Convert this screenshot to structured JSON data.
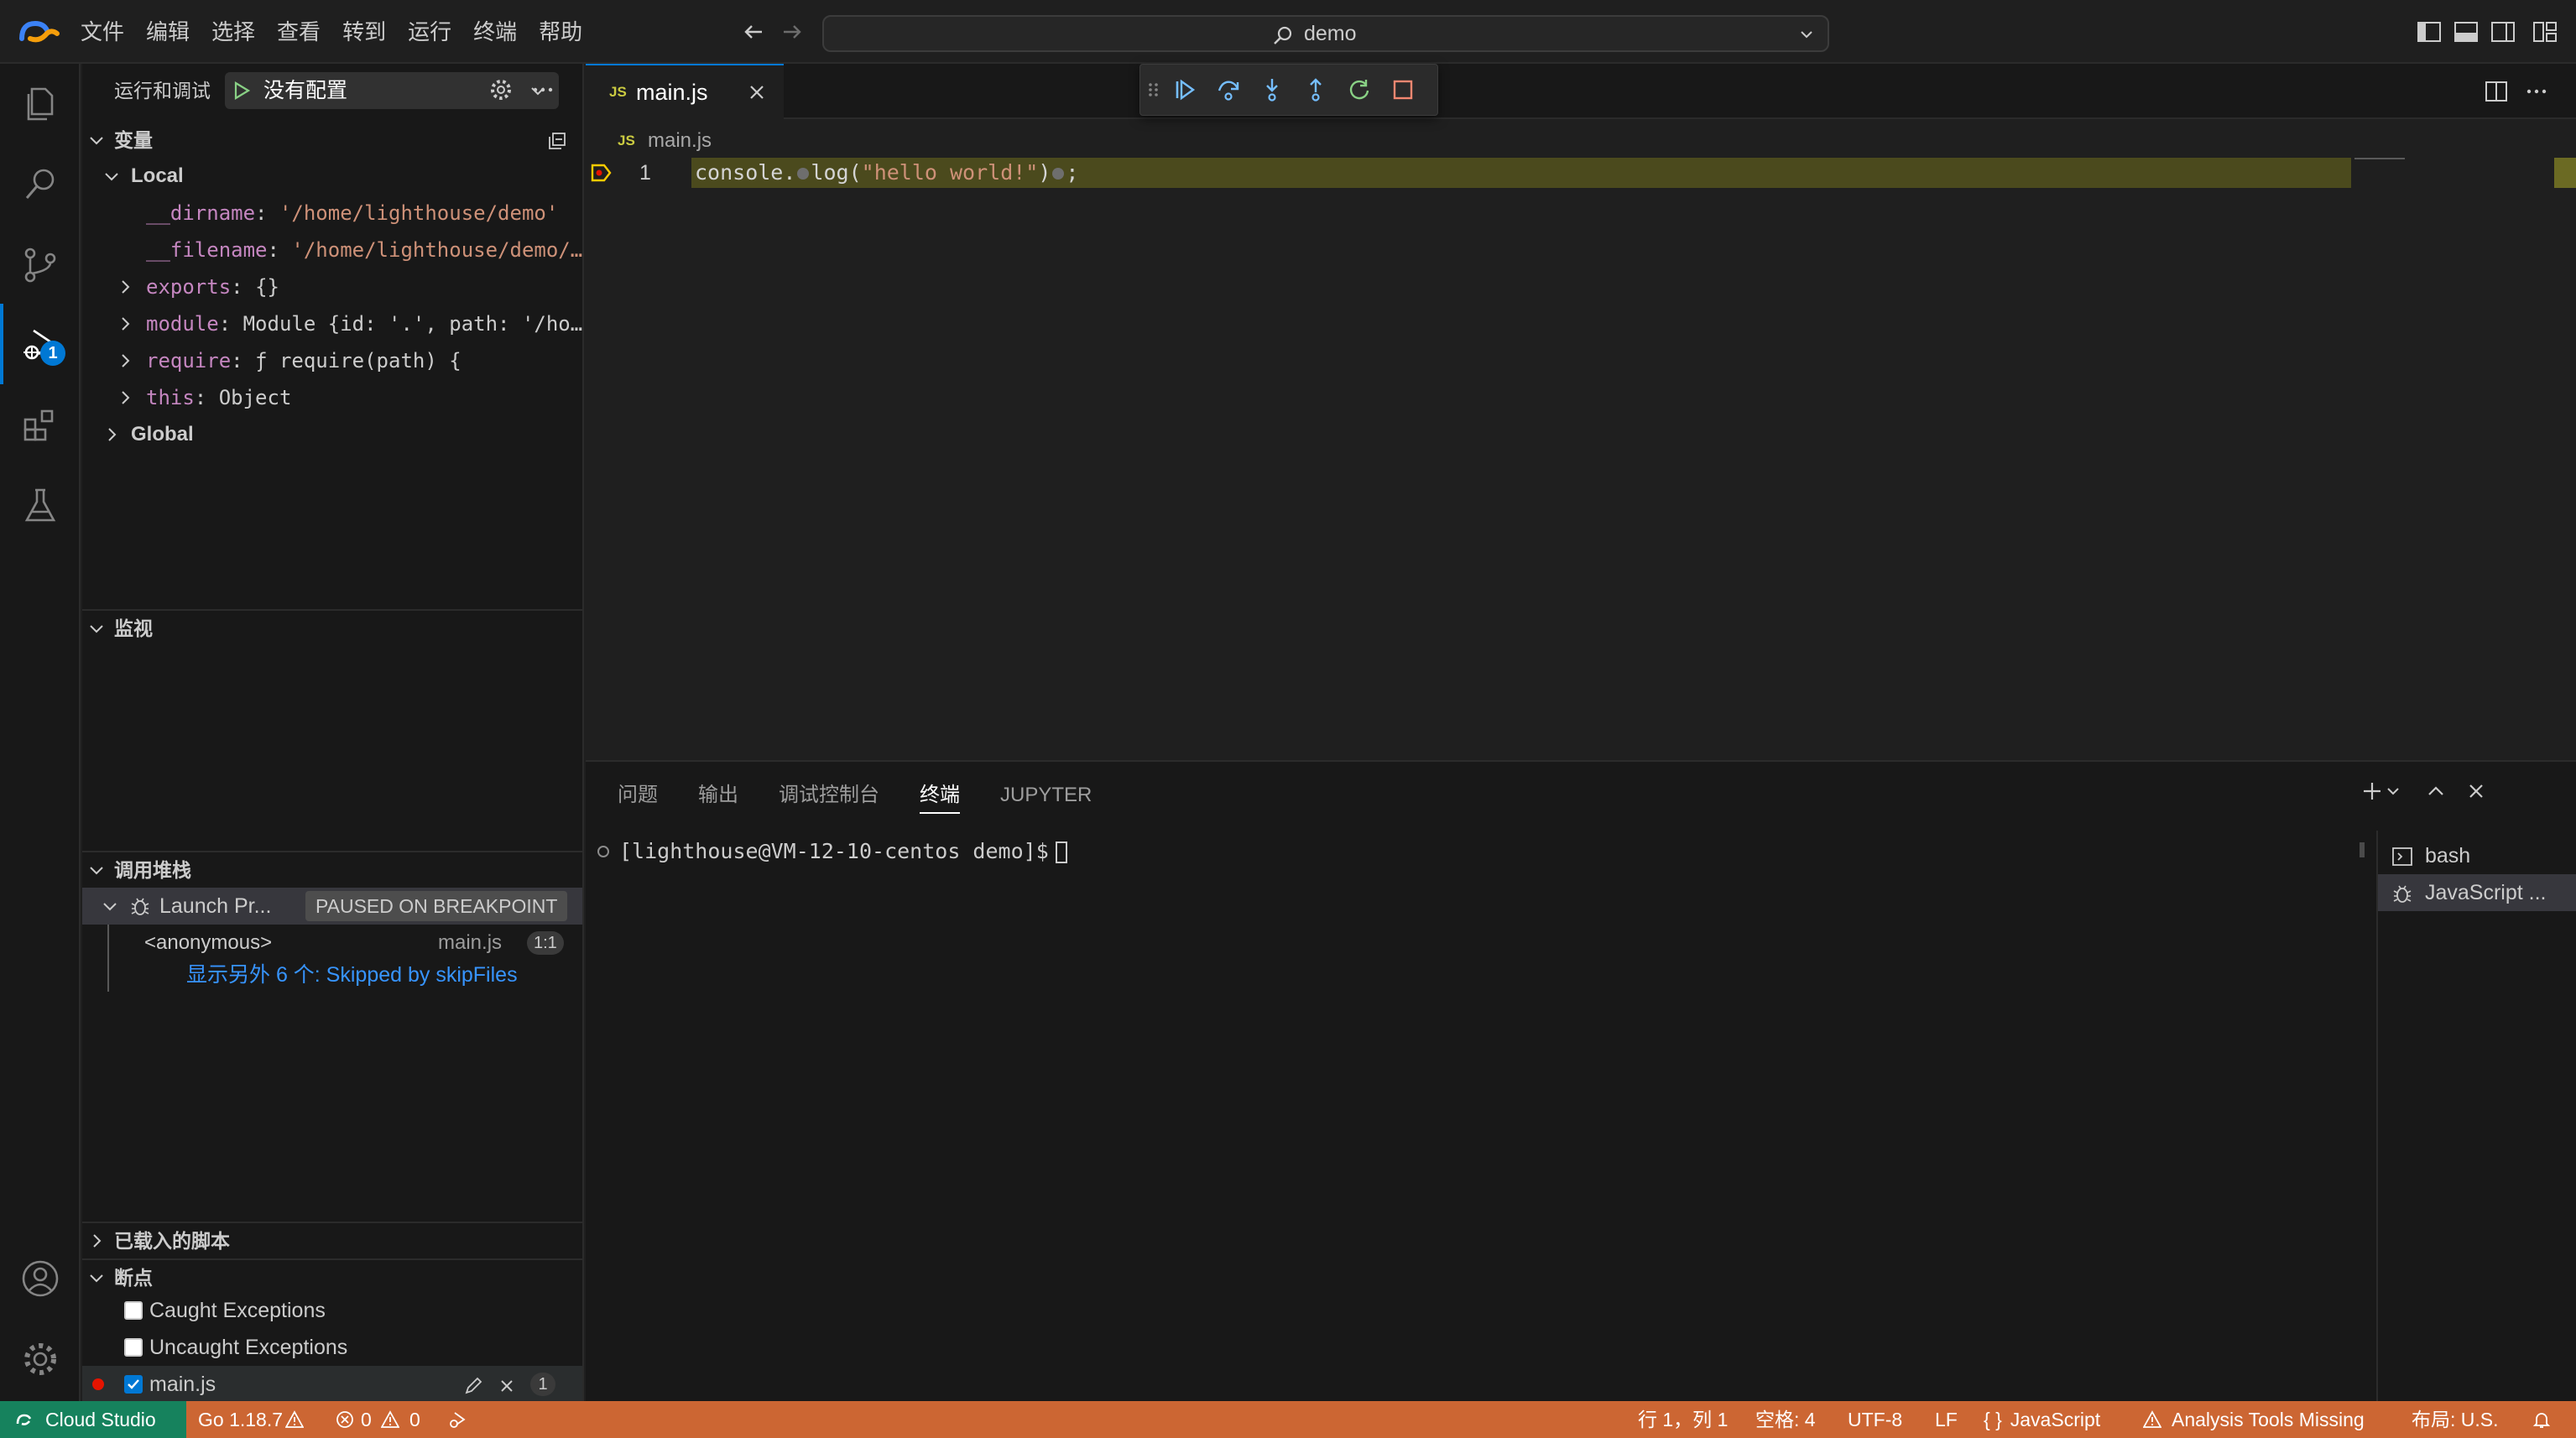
{
  "menu": [
    "文件",
    "编辑",
    "选择",
    "查看",
    "转到",
    "运行",
    "终端",
    "帮助"
  ],
  "command_center": {
    "label": "demo"
  },
  "sidebar": {
    "title": "运行和调试",
    "run_config": "没有配置",
    "variables": {
      "title": "变量",
      "local_label": "Local",
      "items": [
        {
          "name": "__dirname",
          "value": "'/home/lighthouse/demo'"
        },
        {
          "name": "__filename",
          "value": "'/home/lighthouse/demo/…"
        },
        {
          "name": "exports",
          "value": "{}"
        },
        {
          "name": "module",
          "value": "Module {id: '.', path: '/ho…"
        },
        {
          "name": "require",
          "value": "ƒ require(path) {"
        },
        {
          "name": "this",
          "value": "Object"
        }
      ],
      "global_label": "Global"
    },
    "watch": {
      "title": "监视"
    },
    "call_stack": {
      "title": "调用堆栈",
      "thread": "Launch Pr...",
      "status": "PAUSED ON BREAKPOINT",
      "frame": {
        "name": "<anonymous>",
        "file": "main.js",
        "pos": "1:1"
      },
      "skipped": "显示另外 6 个: Skipped by skipFiles"
    },
    "loaded_scripts": {
      "title": "已载入的脚本"
    },
    "breakpoints": {
      "title": "断点",
      "items": [
        {
          "label": "Caught Exceptions",
          "checked": false
        },
        {
          "label": "Uncaught Exceptions",
          "checked": false
        },
        {
          "label": "main.js",
          "checked": true,
          "count": "1"
        }
      ]
    }
  },
  "editor": {
    "tab": {
      "badge": "JS",
      "label": "main.js"
    },
    "breadcrumb": {
      "badge": "JS",
      "file": "main.js"
    },
    "line_number": "1",
    "code": {
      "p1": "console.",
      "p2": "log(",
      "p3": "\"hello world!\"",
      "p4": ")",
      "p5": ";"
    }
  },
  "panel": {
    "tabs": [
      "问题",
      "输出",
      "调试控制台",
      "终端",
      "JUPYTER"
    ],
    "active_tab": "终端",
    "prompt": "[lighthouse@VM-12-10-centos demo]$",
    "terminals": [
      {
        "label": "bash",
        "icon": "terminal-icon"
      },
      {
        "label": "JavaScript ...",
        "icon": "debug-icon"
      }
    ]
  },
  "activity_bar": {
    "icons": [
      "explorer-icon",
      "search-icon",
      "source-control-icon",
      "run-debug-icon",
      "extensions-icon",
      "testing-icon",
      "account-icon",
      "manage-gear-icon"
    ],
    "debug_badge": "1"
  },
  "status_bar": {
    "remote": "Cloud Studio",
    "go_version": "Go 1.18.7",
    "errors": "0",
    "warnings": "0",
    "position": "行 1，列 1",
    "spaces": "空格: 4",
    "encoding": "UTF-8",
    "eol": "LF",
    "language": "JavaScript",
    "analysis": "Analysis Tools Missing",
    "layout": "布局: U.S."
  },
  "colors": {
    "status_bar_bg": "#cc6633",
    "remote_bg": "#16825d",
    "accent": "#0078d4",
    "paused_line": "#4b4a1d",
    "breakpoint": "#e51400"
  }
}
